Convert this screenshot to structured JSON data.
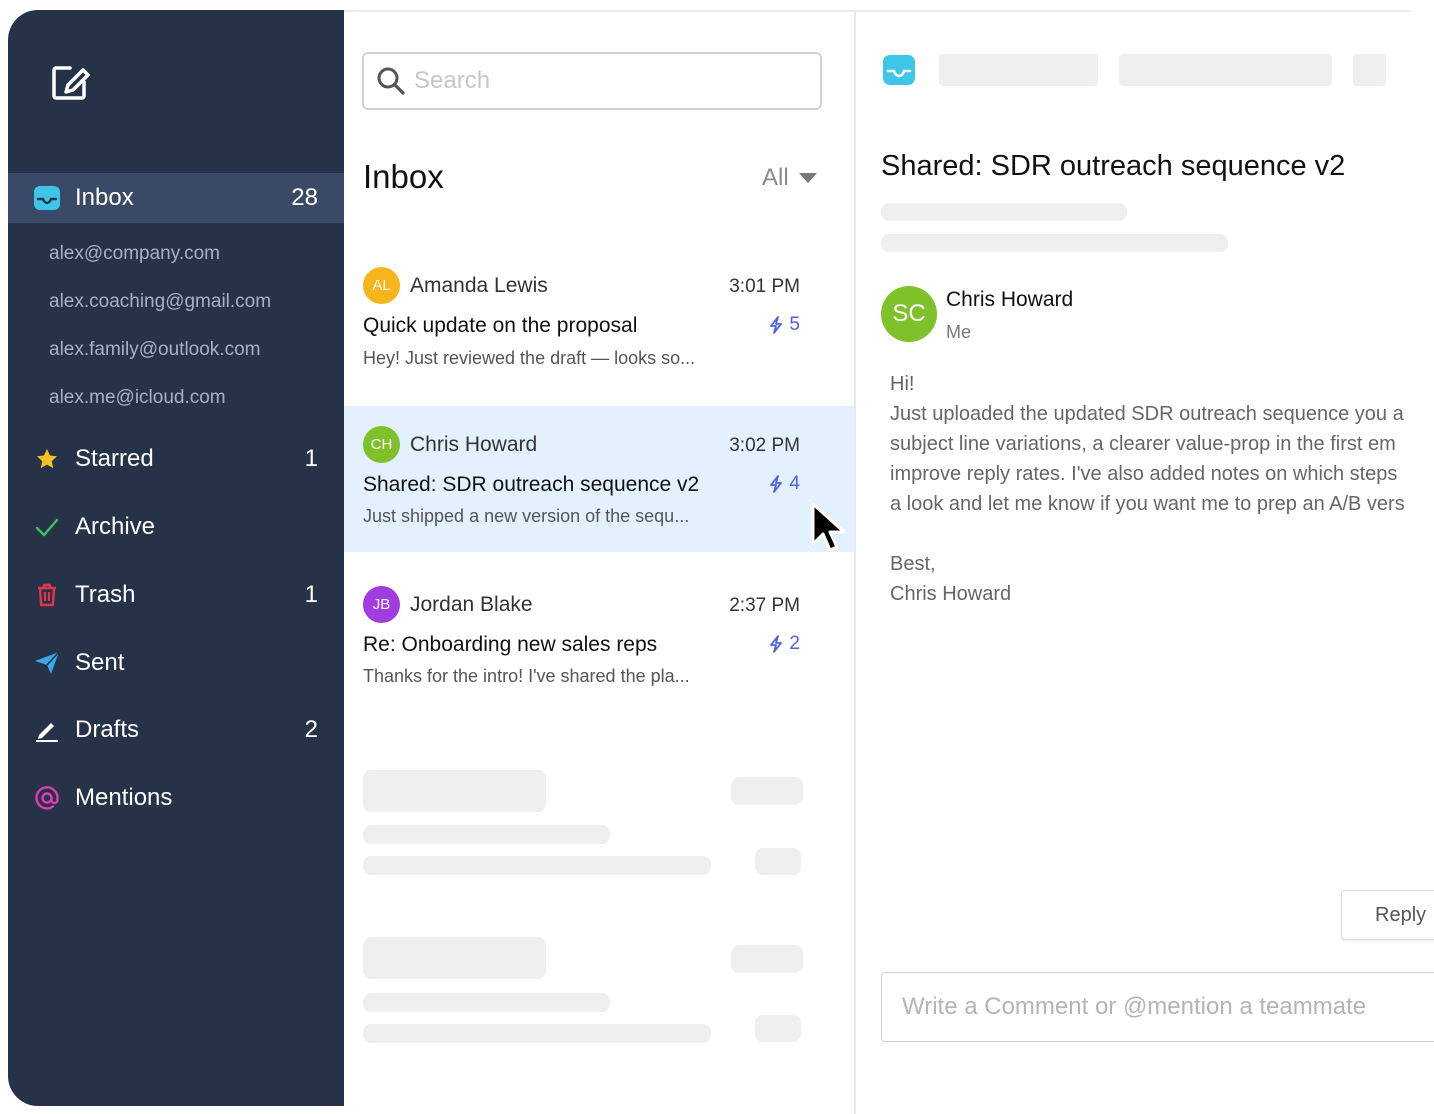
{
  "sidebar": {
    "compose_icon": "compose-icon",
    "inbox": {
      "label": "Inbox",
      "count": "28",
      "icon": "inbox-tray-icon",
      "color": "#3ec6e8"
    },
    "accounts": [
      "alex@company.com",
      "alex.coaching@gmail.com",
      "alex.family@outlook.com",
      "alex.me@icloud.com"
    ],
    "folders": [
      {
        "label": "Starred",
        "count": "1",
        "icon": "star-icon",
        "color": "#f6c026"
      },
      {
        "label": "Archive",
        "count": "",
        "icon": "checkmark-icon",
        "color": "#3fc35c"
      },
      {
        "label": "Trash",
        "count": "1",
        "icon": "trash-icon",
        "color": "#e5354d"
      },
      {
        "label": "Sent",
        "count": "",
        "icon": "paper-plane-icon",
        "color": "#3aa8e8"
      },
      {
        "label": "Drafts",
        "count": "2",
        "icon": "pencil-icon",
        "color": "#ffffff"
      },
      {
        "label": "Mentions",
        "count": "",
        "icon": "at-sign-icon",
        "color": "#e13bb0"
      }
    ]
  },
  "list": {
    "search_placeholder": "Search",
    "title": "Inbox",
    "filter": "All",
    "messages": [
      {
        "initials": "AL",
        "avatar_color": "#f5b51b",
        "sender": "Amanda Lewis",
        "time": "3:01 PM",
        "subject": "Quick update on the proposal",
        "preview": "Hey! Just reviewed the draft — looks so...",
        "badge": "5"
      },
      {
        "initials": "CH",
        "avatar_color": "#7ec12a",
        "sender": "Chris Howard",
        "time": "3:02 PM",
        "subject": "Shared: SDR outreach sequence v2",
        "preview": "Just shipped a new version of the sequ...",
        "badge": "4",
        "selected": true
      },
      {
        "initials": "JB",
        "avatar_color": "#a23ce0",
        "sender": "Jordan Blake",
        "time": "2:37 PM",
        "subject": "Re: Onboarding new sales reps",
        "preview": "Thanks for the intro! I've shared the pla...",
        "badge": "2"
      }
    ]
  },
  "reader": {
    "app_icon": "inbox-tray-icon",
    "subject": "Shared: SDR outreach sequence v2",
    "from_initials": "SC",
    "from_name": "Chris Howard",
    "to": "Me",
    "body_lines": [
      "Hi!",
      "Just uploaded the updated SDR outreach sequence you a",
      "subject line variations, a clearer value-prop in the first em",
      "improve reply rates. I've also added notes on which steps",
      "a look and let me know if you want me to prep an A/B vers",
      "",
      "Best,",
      "Chris Howard"
    ],
    "reply_label": "Reply",
    "comment_placeholder": "Write a Comment or @mention a teammate"
  }
}
